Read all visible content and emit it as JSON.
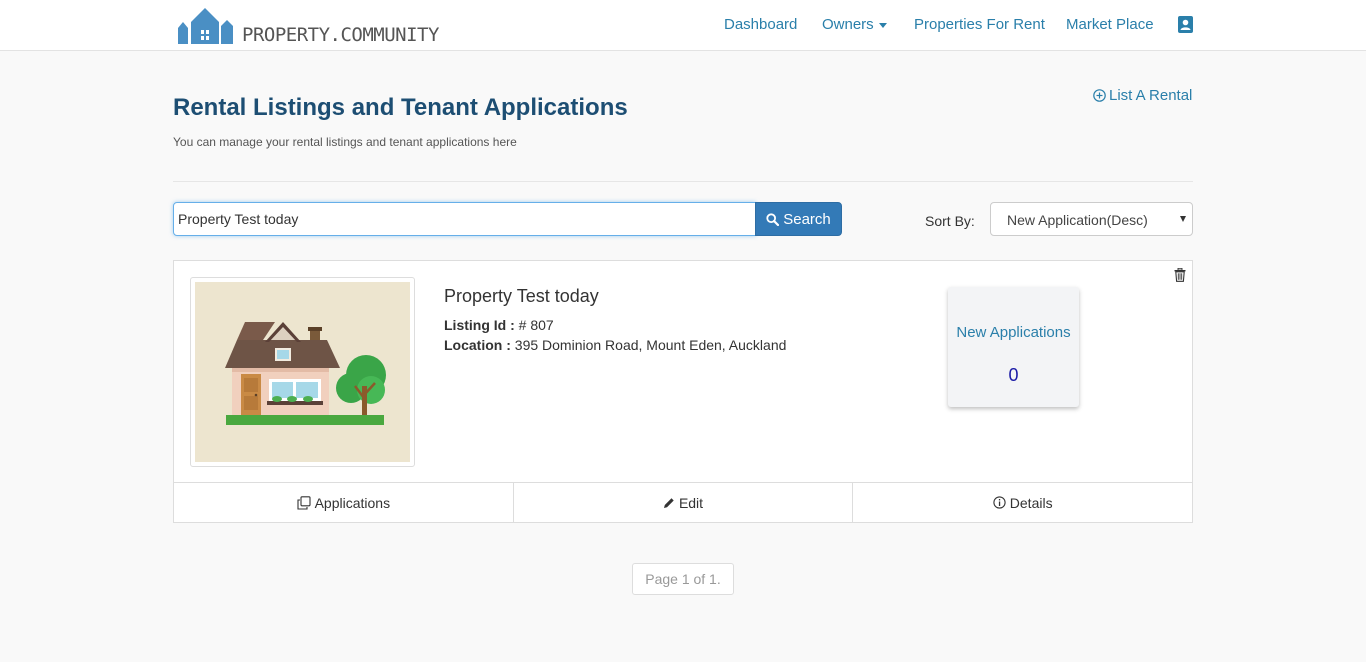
{
  "brand": {
    "name": "PROPERTY.COMMUNITY",
    "color": "#4a8fc4"
  },
  "nav": {
    "dashboard": "Dashboard",
    "owners": "Owners",
    "properties_for_rent": "Properties For Rent",
    "market_place": "Market Place",
    "user_icon": "user-profile-icon"
  },
  "header": {
    "title": "Rental Listings and Tenant Applications",
    "subtitle": "You can manage your rental listings and tenant applications here",
    "list_rental": "List A Rental"
  },
  "search": {
    "value": "Property Test today",
    "button": "Search"
  },
  "sort": {
    "label": "Sort By:",
    "selected": "New Application(Desc)"
  },
  "listing": {
    "name": "Property Test today",
    "listing_id_label": "Listing Id :",
    "listing_id_value": "# 807",
    "location_label": "Location :",
    "location_value": "395 Dominion Road, Mount Eden, Auckland",
    "new_applications_label": "New Applications",
    "new_applications_count": "0",
    "actions": {
      "applications": "Applications",
      "edit": "Edit",
      "details": "Details"
    }
  },
  "pager": {
    "text": "Page 1 of 1."
  },
  "colors": {
    "accent": "#2a7faa",
    "button": "#337ab7",
    "title": "#1d4e73"
  }
}
